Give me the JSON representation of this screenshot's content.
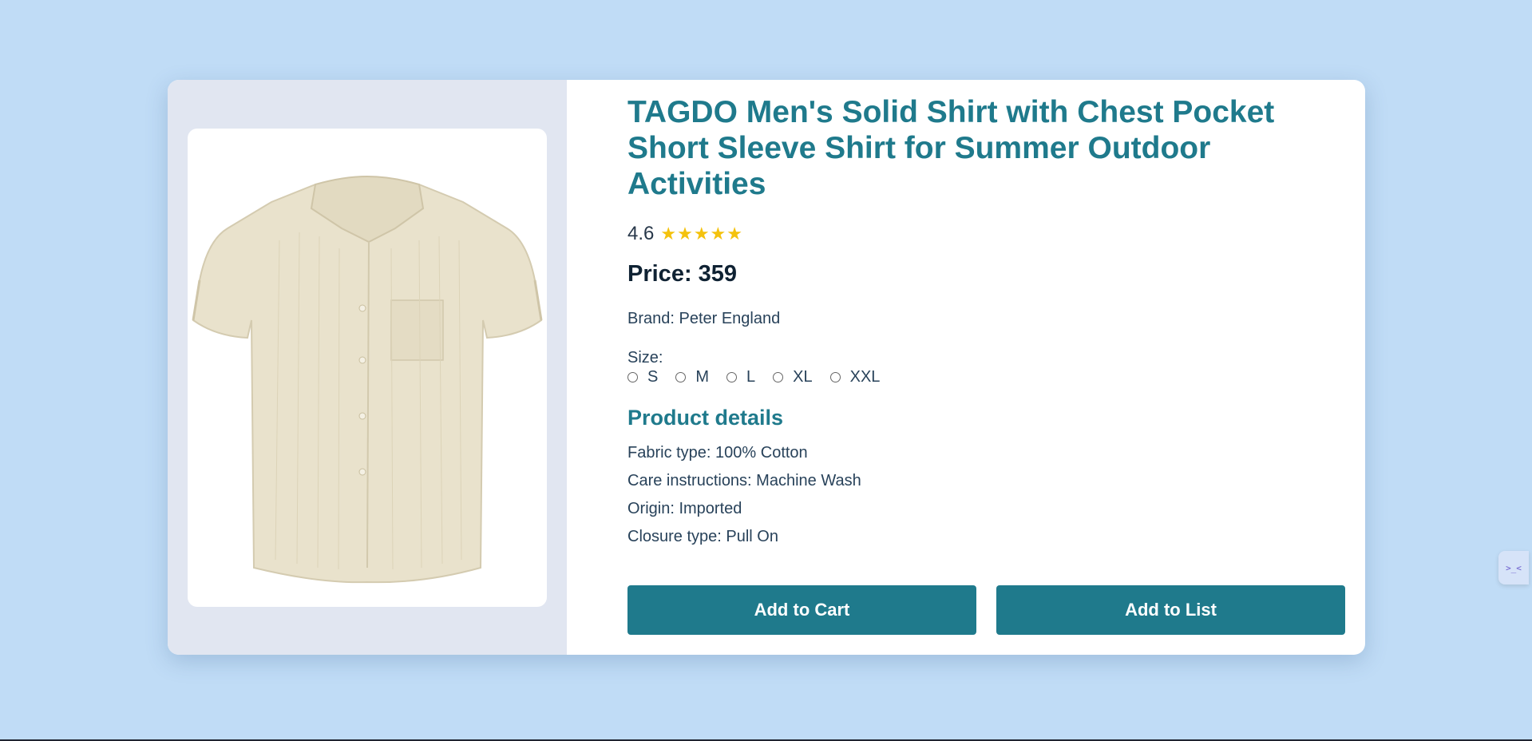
{
  "product": {
    "title": "TAGDO Men's Solid Shirt with Chest Pocket Short Sleeve Shirt for Summer Outdoor Activities",
    "rating": "4.6",
    "stars": "★★★★★",
    "rating_value": 4.6,
    "price_label": "Price: 359",
    "brand": "Brand: Peter England",
    "size_label": "Size:",
    "sizes": [
      "S",
      "M",
      "L",
      "XL",
      "XXL"
    ],
    "details_heading": "Product details",
    "details": [
      "Fabric type: 100% Cotton",
      "Care instructions: Machine Wash",
      "Origin: Imported",
      "Closure type: Pull On"
    ]
  },
  "actions": {
    "add_to_cart": "Add to Cart",
    "add_to_list": "Add to List"
  },
  "widget": {
    "glyph": ">_<"
  },
  "colors": {
    "background": "#c0dcf6",
    "accent": "#1f7a8c",
    "star": "#f4c20d",
    "shirt": "#e9e2cc"
  },
  "icons": {
    "product_image": "shirt-icon",
    "side_widget": "assistant-icon"
  }
}
